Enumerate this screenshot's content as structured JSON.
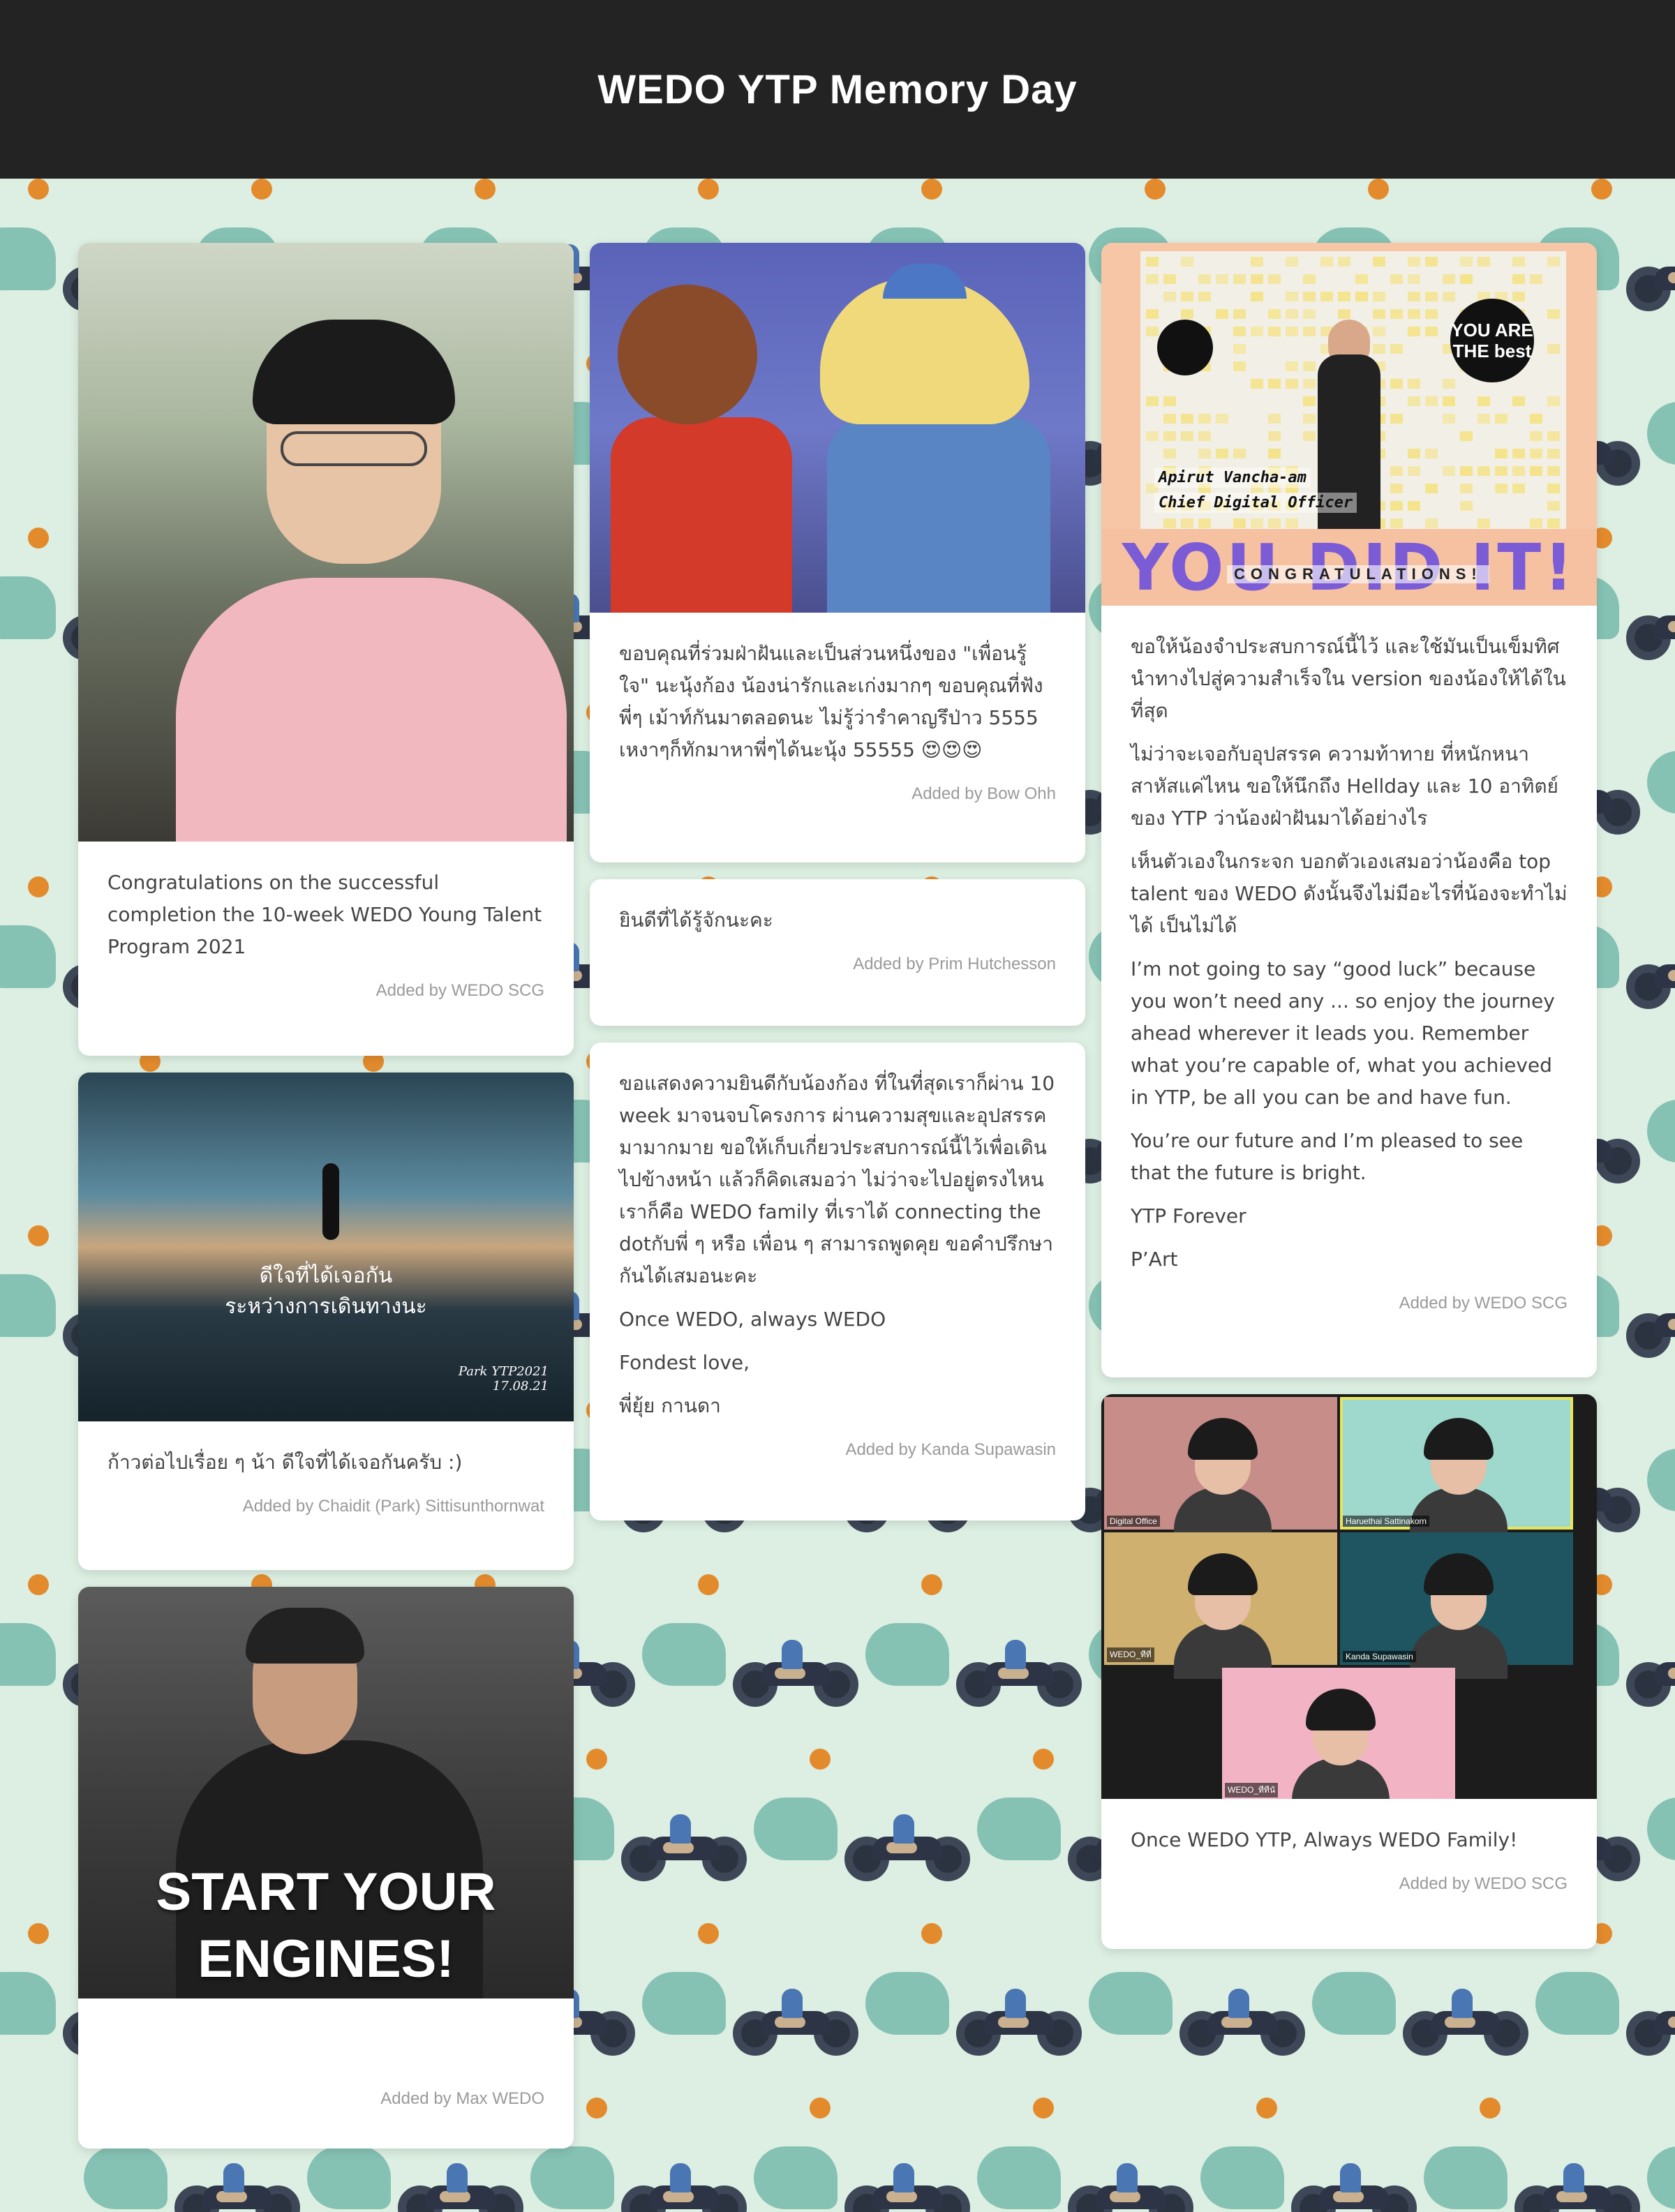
{
  "header": {
    "title": "WEDO YTP Memory Day"
  },
  "cards": {
    "c1": {
      "text": [
        "Congratulations on the successful completion the 10-week WEDO Young Talent Program 2021"
      ],
      "author": "Added by WEDO SCG"
    },
    "c2": {
      "text": [
        "ขอบคุณที่ร่วมฝ่าฝันและเป็นส่วนหนึ่งของ \"เพื่อนรู้ใจ\" นะนุ้งก้อง น้องน่ารักและเก่งมากๆ ขอบคุณที่ฟังพี่ๆ เม้าท์กันมาตลอดนะ ไม่รู้ว่ารำคาญรึป่าว 5555 เหงาๆก็ทักมาหาพี่ๆได้นะนุ้ง 55555 😍😍😍"
      ],
      "author": "Added by Bow Ohh"
    },
    "c3": {
      "image": {
        "caption_line1": "Apirut Vancha-am",
        "caption_line2": "Chief Digital Officer",
        "badge": "YOU ARE THE best",
        "banner": "YOU DID IT!",
        "subbanner": "CONGRATULATIONS!"
      },
      "text": [
        "ขอให้น้องจำประสบการณ์นี้ไว้ และใช้มันเป็นเข็มทิศนำทางไปสู่ความสำเร็จใน version ของน้องให้ได้ในที่สุด",
        "ไม่ว่าจะเจอกับอุปสรรค ความท้าทาย ที่หนักหนาสาหัสแค่ไหน ขอให้นึกถึง Hellday และ 10 อาทิตย์ของ YTP ว่าน้องฝ่าฝันมาได้อย่างไร",
        "เห็นตัวเองในกระจก บอกตัวเองเสมอว่าน้องคือ top talent ของ WEDO ดังนั้นจึงไม่มีอะไรที่น้องจะทำไม่ได้ เป็นไม่ได้",
        "I’m not going to say “good luck” because you won’t need any ... so enjoy the journey ahead wherever it leads you. Remember what you’re capable of, what you achieved in YTP, be all you can be and have fun.",
        "You’re our future and I’m pleased to see that the future is bright.",
        "YTP Forever",
        "P’Art"
      ],
      "author": "Added by WEDO SCG"
    },
    "c4": {
      "text": [
        "ยินดีที่ได้รู้จักนะคะ"
      ],
      "author": "Added by Prim Hutchesson"
    },
    "c5": {
      "image": {
        "line1": "ดีใจที่ได้เจอกัน",
        "line2": "ระหว่างการเดินทางนะ",
        "sig1": "Park YTP2021",
        "sig2": "17.08.21"
      },
      "text": [
        "ก้าวต่อไปเรื่อย ๆ น้า ดีใจที่ได้เจอกันครับ :)"
      ],
      "author": "Added by Chaidit (Park) Sittisunthornwat"
    },
    "c6": {
      "text": [
        "ขอแสดงความยินดีกับน้องก้อง ที่ในที่สุดเราก็ผ่าน 10 week มาจนจบโครงการ ผ่านความสุขและอุปสรรคมามากมาย ขอให้เก็บเกี่ยวประสบการณ์นี้ไว้เพื่อเดินไปข้างหน้า แล้วก็คิดเสมอว่า ไม่ว่าจะไปอยู่ตรงไหนเราก็คือ WEDO family ที่เราได้ connecting the dotกับพี่ ๆ หรือ เพื่อน ๆ สามารถพูดคุย ขอคำปรึกษากันได้เสมอนะคะ",
        "Once WEDO, always WEDO",
        "Fondest love,",
        "พี่ยุ้ย กานดา"
      ],
      "author": "Added by Kanda Supawasin"
    },
    "c7": {
      "image": {
        "names": [
          "Digital Office",
          "Haruethai Sattinakorn",
          "WEDO_ทีที่",
          "Kanda Supawasin",
          "WEDO_ทีทีนั"
        ]
      },
      "text": [
        "Once WEDO YTP, Always WEDO Family!"
      ],
      "author": "Added by WEDO SCG"
    },
    "c8": {
      "image": {
        "caption_line1": "START YOUR",
        "caption_line2": "ENGINES!"
      },
      "text": [],
      "author": "Added by Max WEDO"
    }
  },
  "colors": {
    "header_bg": "#232323",
    "page_bg": "#dcefe2",
    "accent_dot": "#e38b2c",
    "leaf": "#7bbcaf"
  }
}
